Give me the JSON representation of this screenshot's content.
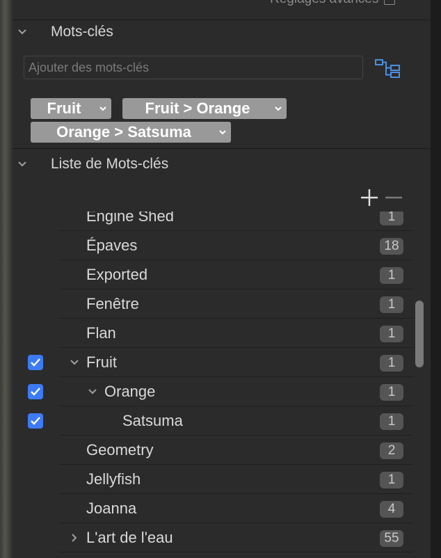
{
  "top_cut_label": "Réglages avancés",
  "keywords_section": {
    "title": "Mots-clés",
    "input_placeholder": "Ajouter des mots-clés",
    "chips": [
      "Fruit",
      "Fruit > Orange",
      "Orange > Satsuma"
    ]
  },
  "keyword_list_section": {
    "title": "Liste de Mots-clés",
    "add_label": "+",
    "remove_label": "—",
    "rows": [
      {
        "label": "Engine Shed",
        "count": "1",
        "level": 0,
        "checked": false,
        "expand": "none"
      },
      {
        "label": "Épaves",
        "count": "18",
        "level": 0,
        "checked": false,
        "expand": "none"
      },
      {
        "label": "Exported",
        "count": "1",
        "level": 0,
        "checked": false,
        "expand": "none"
      },
      {
        "label": "Fenêtre",
        "count": "1",
        "level": 0,
        "checked": false,
        "expand": "none"
      },
      {
        "label": "Flan",
        "count": "1",
        "level": 0,
        "checked": false,
        "expand": "none"
      },
      {
        "label": "Fruit",
        "count": "1",
        "level": 0,
        "checked": true,
        "expand": "open"
      },
      {
        "label": "Orange",
        "count": "1",
        "level": 1,
        "checked": true,
        "expand": "open"
      },
      {
        "label": "Satsuma",
        "count": "1",
        "level": 2,
        "checked": true,
        "expand": "none"
      },
      {
        "label": "Geometry",
        "count": "2",
        "level": 0,
        "checked": false,
        "expand": "none"
      },
      {
        "label": "Jellyfish",
        "count": "1",
        "level": 0,
        "checked": false,
        "expand": "none"
      },
      {
        "label": "Joanna",
        "count": "4",
        "level": 0,
        "checked": false,
        "expand": "none"
      },
      {
        "label": "L'art de l'eau",
        "count": "55",
        "level": 0,
        "checked": false,
        "expand": "closed"
      }
    ]
  },
  "colors": {
    "accent": "#3d7bf5",
    "chip_bg": "#999999",
    "badge_bg": "#555555",
    "tree_icon": "#4a90e2"
  }
}
